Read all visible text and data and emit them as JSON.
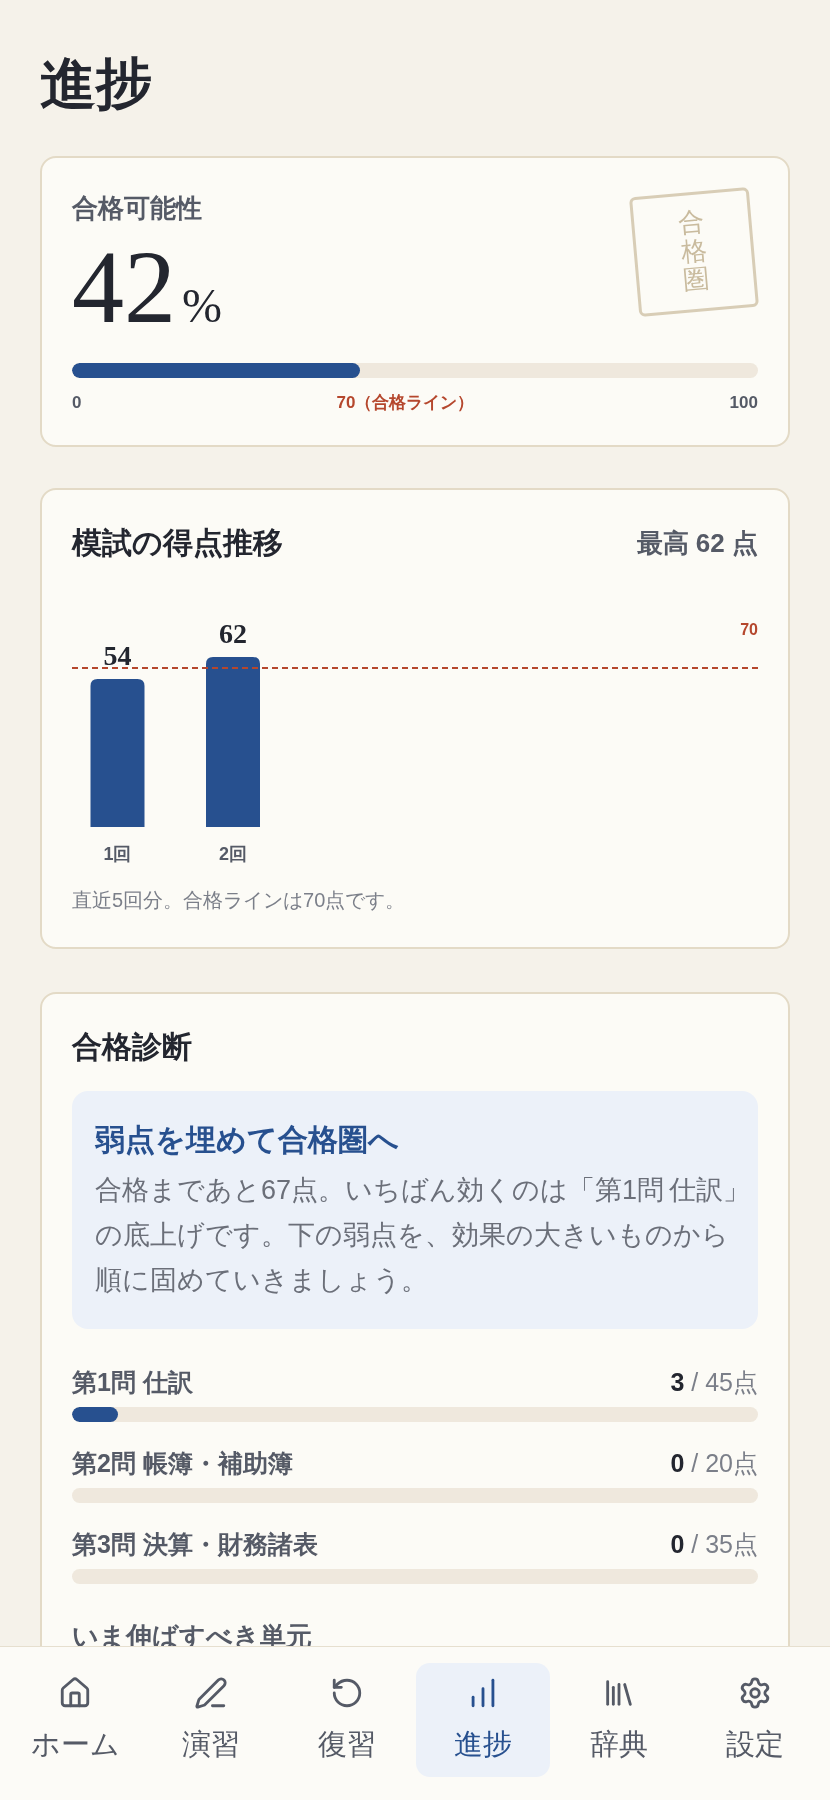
{
  "page": {
    "title": "進捗"
  },
  "pass_card": {
    "label": "合格可能性",
    "value": "42",
    "unit": "%",
    "stamp": "合格圏",
    "level": 0.42,
    "scale": {
      "min": "0",
      "pass_line": "70（合格ライン）",
      "max": "100"
    }
  },
  "score_card": {
    "title": "模試の得点推移",
    "best": "最高 62 点",
    "pass_line_label": "70",
    "chart_data": {
      "type": "bar",
      "categories": [
        "1回",
        "2回"
      ],
      "values": [
        54,
        62
      ],
      "data_labels": true
    },
    "note": "直近5回分。合格ラインは70点です。"
  },
  "diagnosis": {
    "title": "合格診断",
    "advice": {
      "title": "弱点を埋めて合格圏へ",
      "text": "合格まであと67点。いちばん効くのは「第1問 仕訳」の底上げです。下の弱点を、効果の大きいものから順に固めていきましょう。"
    },
    "subjects": [
      {
        "name": "第1問 仕訳",
        "score": "**3** / 45点",
        "level": 0.067
      },
      {
        "name": "第2問 帳簿・補助簿",
        "score": "**0** / 20点",
        "level": 0
      },
      {
        "name": "第3問 決算・財務諸表",
        "score": "**0** / 35点",
        "level": 0
      }
    ],
    "next_heading": "いま伸ばすべき単元"
  },
  "nav": {
    "items": [
      {
        "label": "ホーム",
        "selected": false
      },
      {
        "label": "演習",
        "selected": false
      },
      {
        "label": "復習",
        "selected": false
      },
      {
        "label": "進捗",
        "selected": true
      },
      {
        "label": "辞典",
        "selected": false
      },
      {
        "label": "設定",
        "selected": false
      }
    ]
  }
}
